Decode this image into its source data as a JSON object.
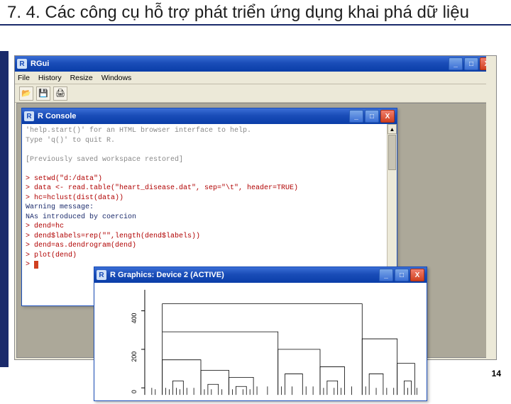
{
  "slide": {
    "title": "7. 4. Các công cụ hỗ trợ phát triển ứng dụng khai phá dữ liệu",
    "page_number": "14"
  },
  "rgui": {
    "title": "RGui",
    "menu": {
      "file": "File",
      "history": "History",
      "resize": "Resize",
      "windows": "Windows"
    },
    "tool_open": "📂",
    "tool_floppy": "💾",
    "tool_print": "🖨"
  },
  "console": {
    "title": "R Console",
    "l1": "'help.start()' for an HTML browser interface to help.",
    "l2": "Type 'q()' to quit R.",
    "l3": "[Previously saved workspace restored]",
    "l4": "> setwd(\"d:/data\")",
    "l5": "> data <- read.table(\"heart_disease.dat\", sep=\"\\t\", header=TRUE)",
    "l6": "> hc=hclust(dist(data))",
    "l7": "Warning message:",
    "l8": "NAs introduced by coercion",
    "l9": "> dend=hc",
    "l10": "> dend$labels=rep(\"\",length(dend$labels))",
    "l11": "> dend=as.dendrogram(dend)",
    "l12": "> plot(dend)",
    "l13": ">"
  },
  "graphics": {
    "title": "R Graphics: Device 2 (ACTIVE)",
    "yticks": [
      "0",
      "200",
      "400"
    ]
  },
  "winbtn": {
    "min": "_",
    "max": "□",
    "close": "X"
  }
}
